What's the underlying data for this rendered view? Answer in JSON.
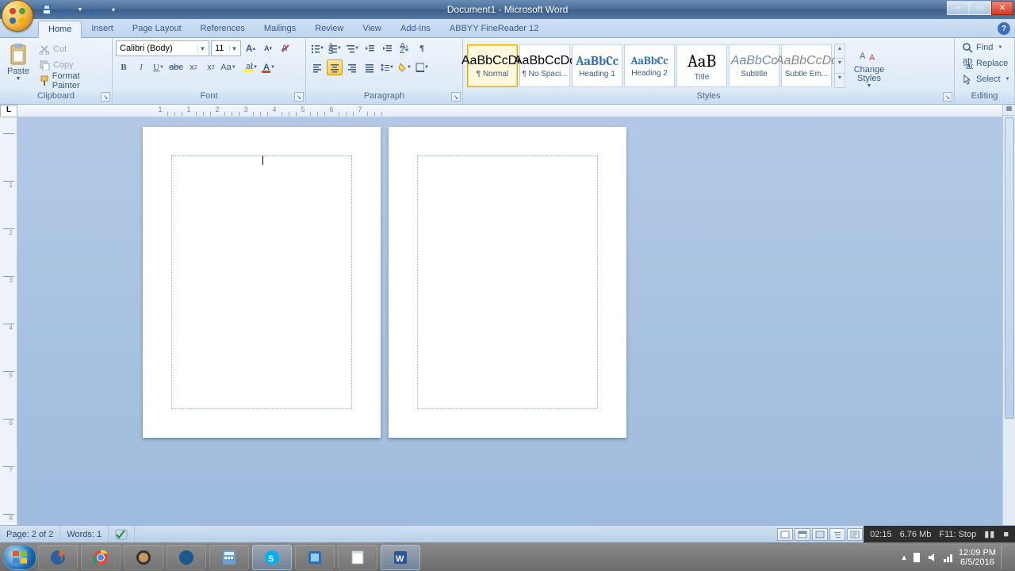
{
  "title": "Document1 - Microsoft Word",
  "qat": {
    "save": "save-icon",
    "undo": "undo-icon",
    "redo": "redo-icon",
    "dd": "qat-dropdown"
  },
  "tabs": [
    "Home",
    "Insert",
    "Page Layout",
    "References",
    "Mailings",
    "Review",
    "View",
    "Add-Ins",
    "ABBYY FineReader 12"
  ],
  "active_tab": 0,
  "clipboard": {
    "paste": "Paste",
    "cut": "Cut",
    "copy": "Copy",
    "fmt": "Format Painter",
    "label": "Clipboard"
  },
  "font": {
    "name": "Calibri (Body)",
    "size": "11",
    "label": "Font",
    "grow": "A▲",
    "shrink": "A▼",
    "clear": "⌫",
    "bold": "B",
    "italic": "I",
    "underline": "U",
    "strike": "abc",
    "sub": "x₂",
    "sup": "x²",
    "case": "Aa▾",
    "hl": "ab",
    "color": "A"
  },
  "paragraph": {
    "label": "Paragraph"
  },
  "styles": {
    "label": "Styles",
    "items": [
      {
        "prev": "AaBbCcDc",
        "name": "¶ Normal",
        "sel": true,
        "cls": ""
      },
      {
        "prev": "AaBbCcDc",
        "name": "¶ No Spaci...",
        "sel": false,
        "cls": ""
      },
      {
        "prev": "AaBbCc",
        "name": "Heading 1",
        "sel": false,
        "cls": "h1"
      },
      {
        "prev": "AaBbCc",
        "name": "Heading 2",
        "sel": false,
        "cls": "h2"
      },
      {
        "prev": "AaB",
        "name": "Title",
        "sel": false,
        "cls": "tt"
      },
      {
        "prev": "AaBbCc",
        "name": "Subtitle",
        "sel": false,
        "cls": "st"
      },
      {
        "prev": "AaBbCcDc",
        "name": "Subtle Em...",
        "sel": false,
        "cls": "se"
      }
    ],
    "change": "Change Styles"
  },
  "editing": {
    "label": "Editing",
    "find": "Find",
    "replace": "Replace",
    "select": "Select"
  },
  "ruler": {
    "nums": [
      "1",
      "1",
      "2",
      "3",
      "4",
      "5",
      "6",
      "7"
    ]
  },
  "status": {
    "page": "Page: 2 of 2",
    "words": "Words: 1",
    "rec_time": "02:15",
    "rec_size": "6.76 Mb",
    "rec_ctrl": "F11: Stop"
  },
  "tray": {
    "time": "12:09 PM",
    "date": "6/5/2016"
  },
  "task_apps": [
    "firefox",
    "chrome",
    "app1",
    "app2",
    "calc",
    "skype",
    "app3",
    "notepad",
    "word"
  ]
}
